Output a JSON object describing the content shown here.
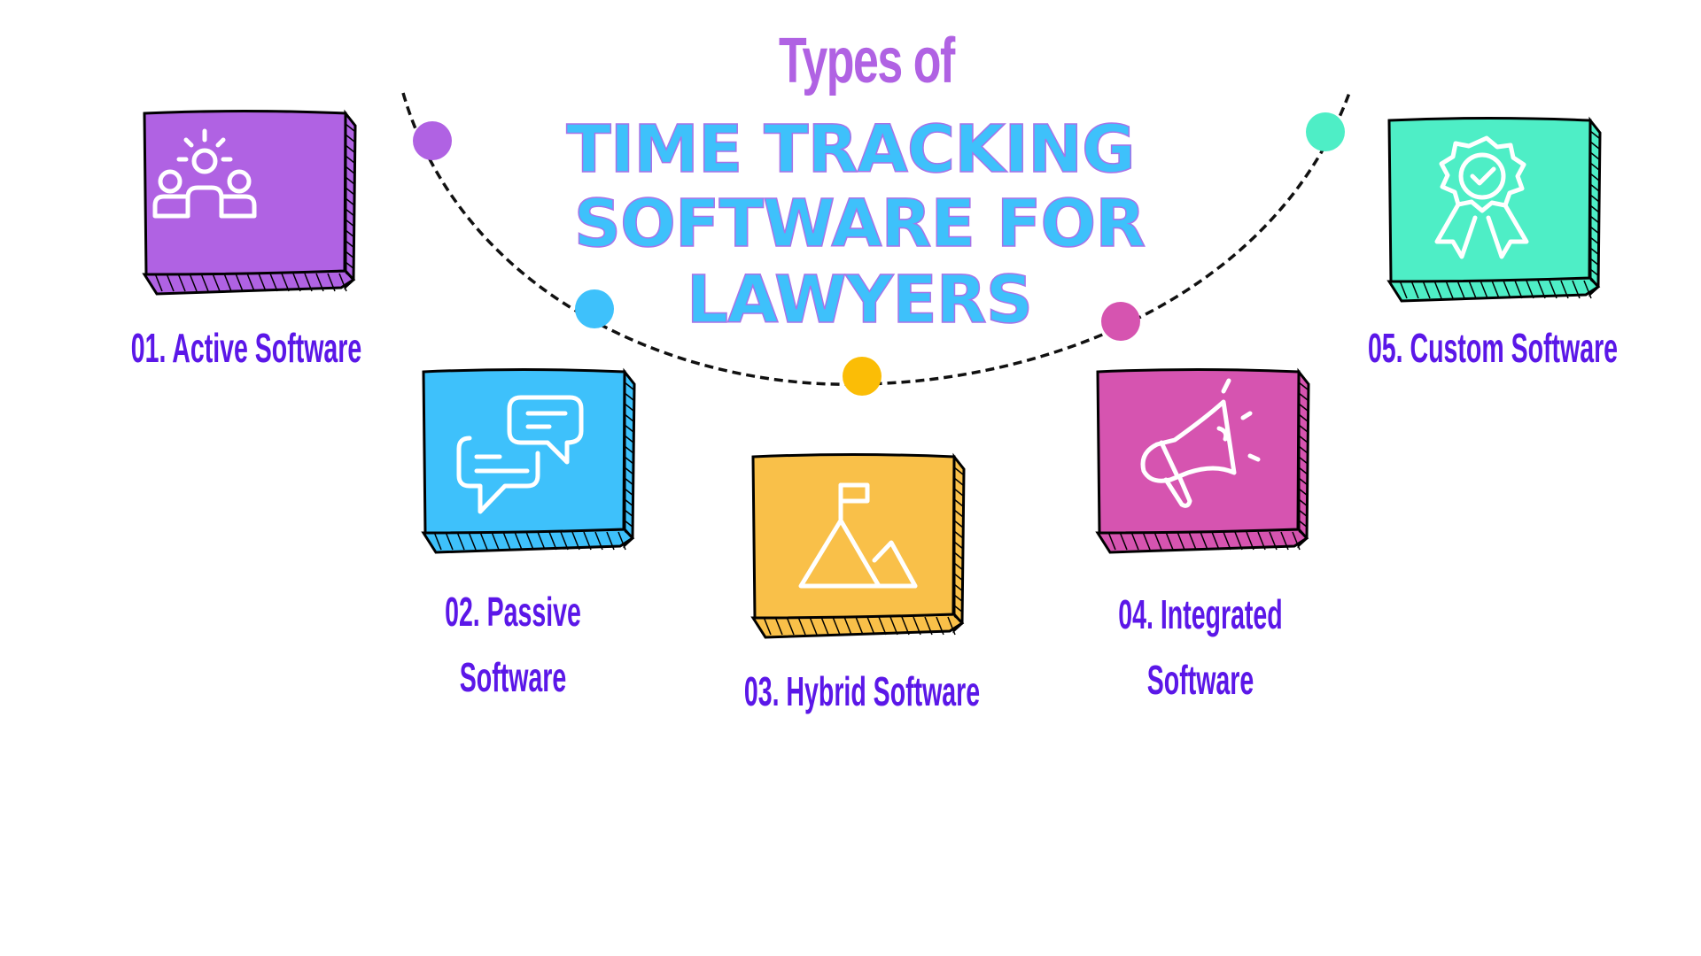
{
  "title": {
    "small": "Types of",
    "lines": [
      "TIME TRACKING",
      "SOFTWARE FOR",
      "LAWYERS"
    ]
  },
  "colors": {
    "title_small": "#b062e3",
    "title_main": "#3ec1fb",
    "label_text": "#5b17e8",
    "arc": "#111111"
  },
  "items": [
    {
      "number": "01.",
      "label_line1": "01. Active Software",
      "label_line2": "",
      "color": "#b062e3",
      "icon": "team-leader-icon"
    },
    {
      "number": "02.",
      "label_line1": "02. Passive",
      "label_line2": "Software",
      "color": "#3ec1fb",
      "icon": "chat-bubbles-icon"
    },
    {
      "number": "03.",
      "label_line1": "03. Hybrid Software",
      "label_line2": "",
      "color": "#f9c049",
      "icon": "mountain-flag-icon"
    },
    {
      "number": "04.",
      "label_line1": "04. Integrated",
      "label_line2": "Software",
      "color": "#d654b0",
      "icon": "megaphone-icon"
    },
    {
      "number": "05.",
      "label_line1": "05. Custom Software",
      "label_line2": "",
      "color": "#4eeec6",
      "icon": "award-badge-icon"
    }
  ],
  "dots": [
    {
      "color": "#b062e3"
    },
    {
      "color": "#3ec1fb"
    },
    {
      "color": "#fbbd06"
    },
    {
      "color": "#d654b0"
    },
    {
      "color": "#4eeec6"
    }
  ]
}
